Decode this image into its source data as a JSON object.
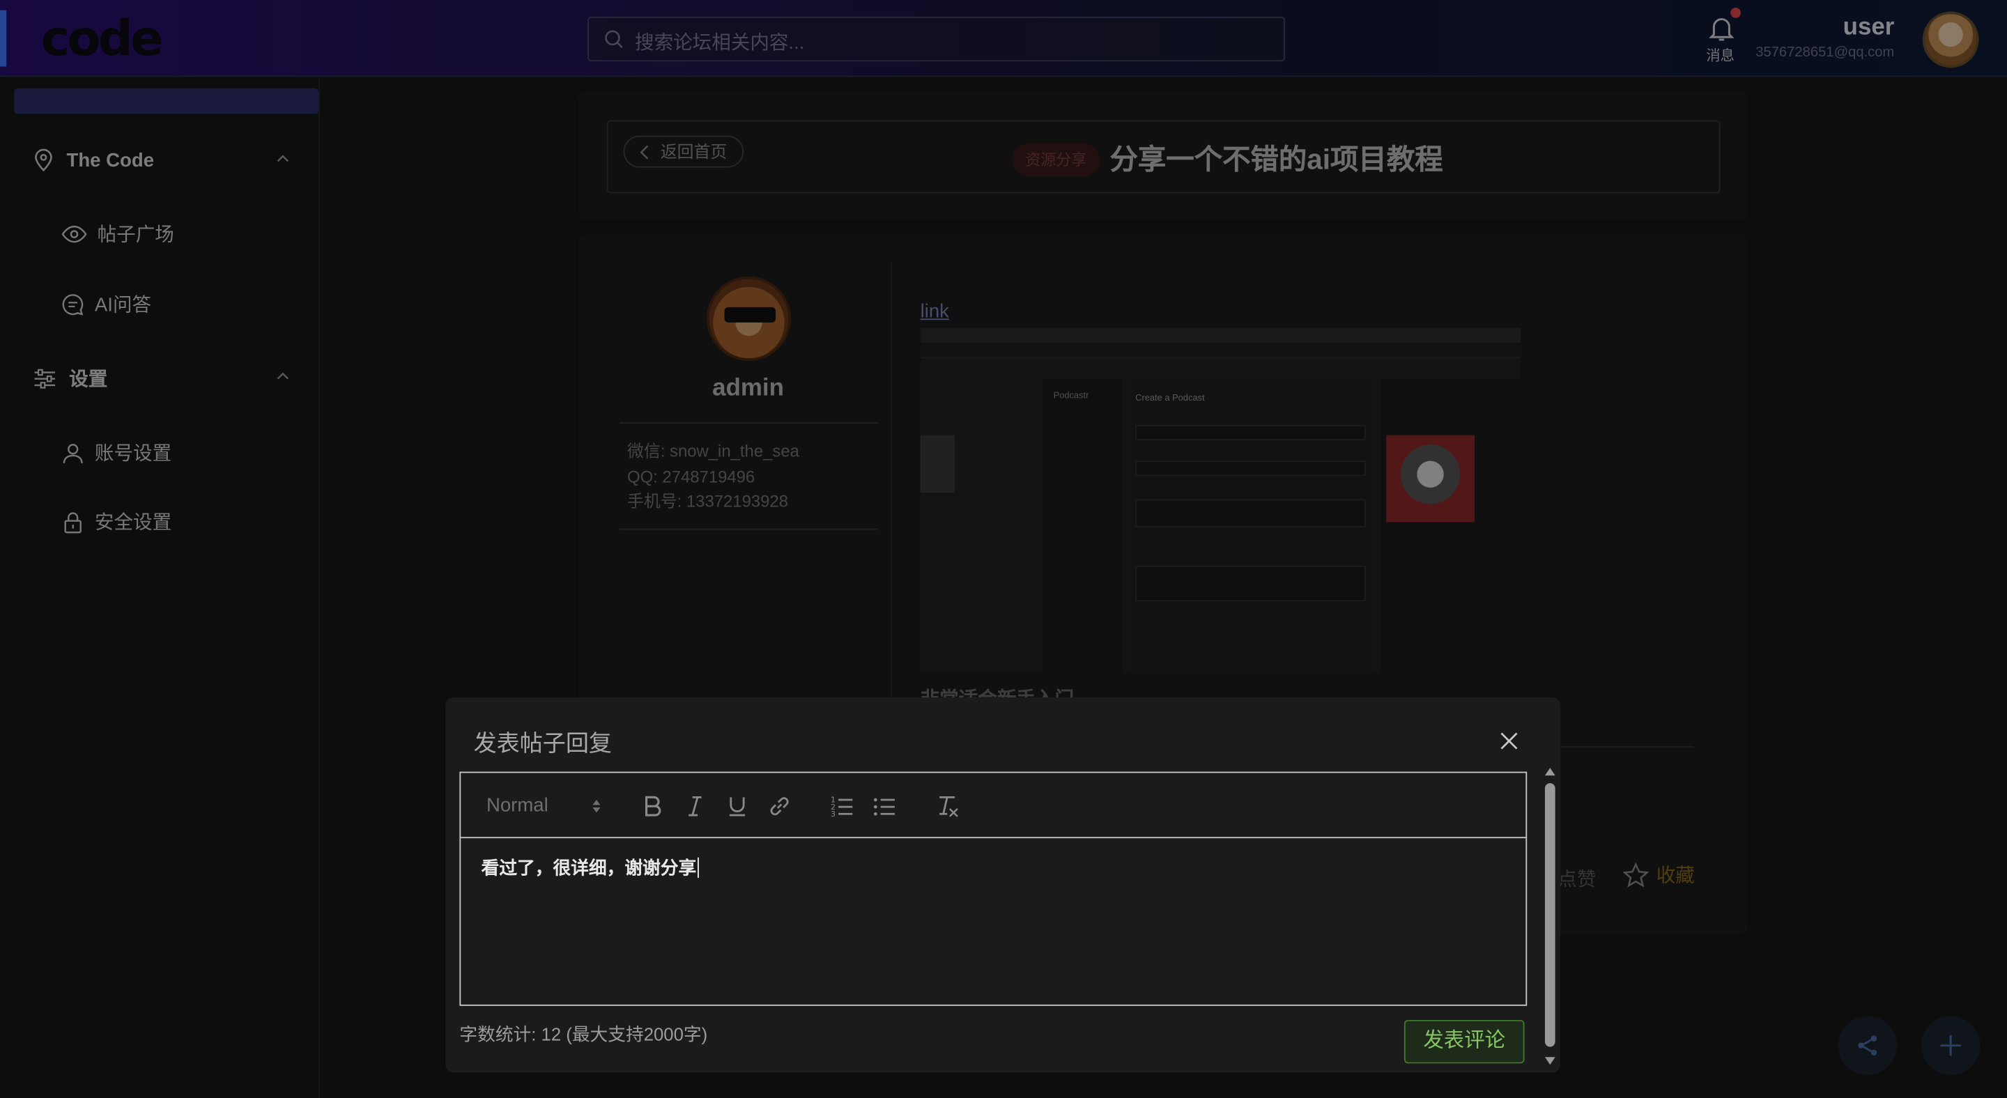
{
  "header": {
    "logo": "code",
    "search_placeholder": "搜索论坛相关内容...",
    "messages_label": "消息",
    "username": "user",
    "email": "3576728651@qq.com"
  },
  "sidebar": {
    "groups": [
      {
        "label": "The Code",
        "icon": "location-pin-icon",
        "items": [
          {
            "label": "帖子广场",
            "icon": "eye-icon"
          },
          {
            "label": "AI问答",
            "icon": "chat-bubble-icon"
          }
        ]
      },
      {
        "label": "设置",
        "icon": "sliders-icon",
        "items": [
          {
            "label": "账号设置",
            "icon": "user-icon"
          },
          {
            "label": "安全设置",
            "icon": "lock-icon"
          }
        ]
      }
    ]
  },
  "post": {
    "back_label": "返回首页",
    "tag": "资源分享",
    "title": "分享一个不错的ai项目教程",
    "author": {
      "name": "admin",
      "wechat": "微信: snow_in_the_sea",
      "qq": "QQ: 2748719496",
      "phone": "手机号: 13372193928"
    },
    "link_text": "link",
    "embedded_image": {
      "app_title": "Podcastr",
      "form_title": "Create a Podcast"
    },
    "partial_text": "非常适合新手入门",
    "like_label": "点赞",
    "favorite_label": "收藏"
  },
  "dialog": {
    "title": "发表帖子回复",
    "format_select": "Normal",
    "content": "看过了，很详细，谢谢分享",
    "counter": "字数统计: 12 (最大支持2000字)",
    "submit_label": "发表评论"
  },
  "colors": {
    "accent_blue": "#3f7bff",
    "submit_green": "#86c464",
    "favorite_gold": "#8a6a1c"
  }
}
